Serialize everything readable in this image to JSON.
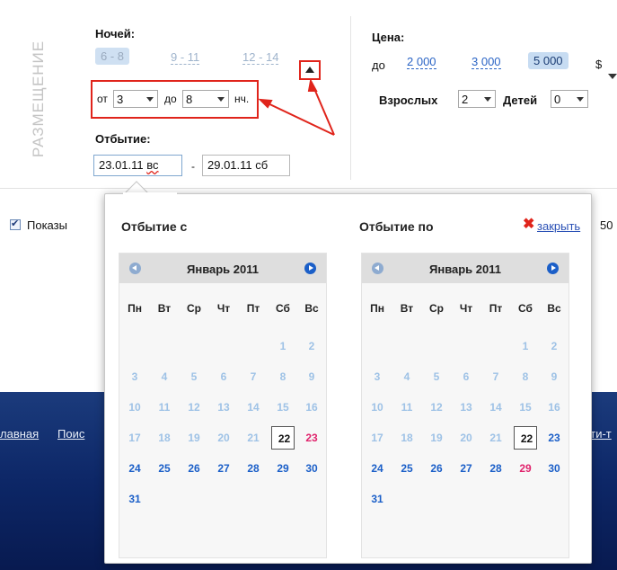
{
  "section_vertical_title": "РАЗМЕЩЕНИЕ",
  "nights": {
    "label": "Ночей:",
    "presets": [
      "6 - 8",
      "9 - 11",
      "12 - 14"
    ],
    "from_label": "от",
    "from_value": "3",
    "to_label": "до",
    "to_value": "8",
    "unit": "нч."
  },
  "departure": {
    "label": "Отбытие:",
    "from_date": "23.01.11",
    "from_dow": "вс",
    "separator": "-",
    "to_date": "29.01.11 сб"
  },
  "price": {
    "label": "Цена:",
    "prefix": "до",
    "options": [
      "2 000",
      "3 000",
      "5 000"
    ],
    "currency": "$"
  },
  "guests": {
    "adults_label": "Взрослых",
    "adults_value": "2",
    "children_label": "Детей",
    "children_value": "0"
  },
  "show_checkbox_label": "Показы",
  "right_cut_text": "50",
  "footer": {
    "link1": "лавная",
    "link2": "Поис",
    "link3": "йти-т"
  },
  "popup": {
    "title_from": "Отбытие с",
    "title_to": "Отбытие по",
    "close_label": "закрыть"
  },
  "calendar": {
    "month_label": "Январь 2011",
    "weekdays": [
      "Пн",
      "Вт",
      "Ср",
      "Чт",
      "Пт",
      "Сб",
      "Вс"
    ],
    "first_weekday_index": 5,
    "days_in_month": 31,
    "left_selected": 22,
    "left_highlight": 23,
    "right_selected": 22,
    "right_highlight": 29,
    "first_active_day": 22
  },
  "colors": {
    "accent_red": "#e0241b",
    "link_blue": "#2a64c5",
    "day_future": "#1b5fc8",
    "day_past": "#9ec2e6",
    "day_highlight": "#e0236c",
    "footer_blue": "#0d2767"
  }
}
